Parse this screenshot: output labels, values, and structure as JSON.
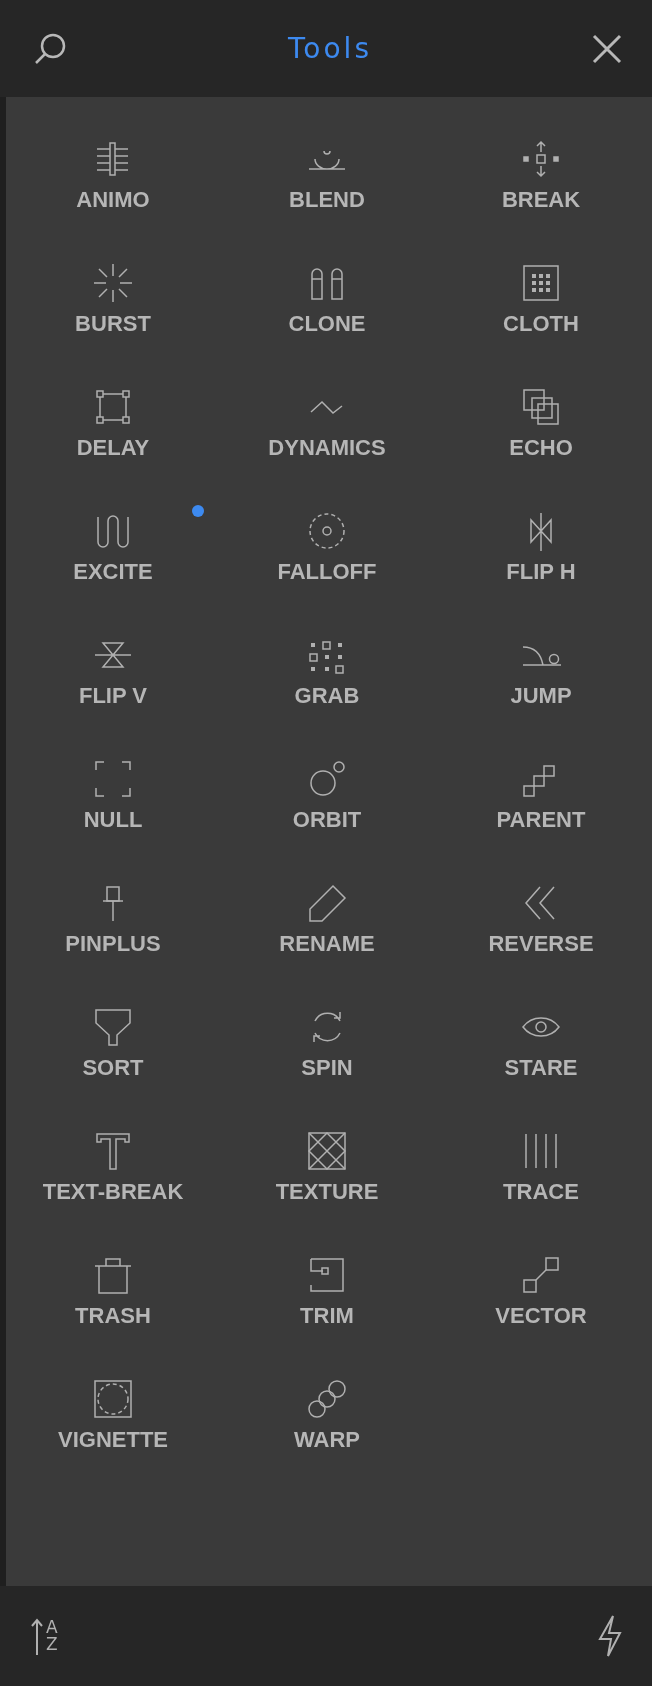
{
  "header": {
    "title": "Tools"
  },
  "tools": [
    {
      "label": "ANIMO",
      "new": false
    },
    {
      "label": "BLEND",
      "new": false
    },
    {
      "label": "BREAK",
      "new": false
    },
    {
      "label": "BURST",
      "new": false
    },
    {
      "label": "CLONE",
      "new": false
    },
    {
      "label": "CLOTH",
      "new": false
    },
    {
      "label": "DELAY",
      "new": false
    },
    {
      "label": "DYNAMICS",
      "new": false
    },
    {
      "label": "ECHO",
      "new": false
    },
    {
      "label": "EXCITE",
      "new": true
    },
    {
      "label": "FALLOFF",
      "new": false
    },
    {
      "label": "FLIP H",
      "new": false
    },
    {
      "label": "FLIP V",
      "new": false
    },
    {
      "label": "GRAB",
      "new": false
    },
    {
      "label": "JUMP",
      "new": false
    },
    {
      "label": "NULL",
      "new": false
    },
    {
      "label": "ORBIT",
      "new": false
    },
    {
      "label": "PARENT",
      "new": false
    },
    {
      "label": "PINPLUS",
      "new": false
    },
    {
      "label": "RENAME",
      "new": false
    },
    {
      "label": "REVERSE",
      "new": false
    },
    {
      "label": "SORT",
      "new": false
    },
    {
      "label": "SPIN",
      "new": false
    },
    {
      "label": "STARE",
      "new": false
    },
    {
      "label": "TEXT-BREAK",
      "new": false
    },
    {
      "label": "TEXTURE",
      "new": false
    },
    {
      "label": "TRACE",
      "new": false
    },
    {
      "label": "TRASH",
      "new": false
    },
    {
      "label": "TRIM",
      "new": false
    },
    {
      "label": "VECTOR",
      "new": false
    },
    {
      "label": "VIGNETTE",
      "new": false
    },
    {
      "label": "WARP",
      "new": false
    }
  ],
  "footer": {
    "sort_letters": [
      "A",
      "Z"
    ]
  }
}
